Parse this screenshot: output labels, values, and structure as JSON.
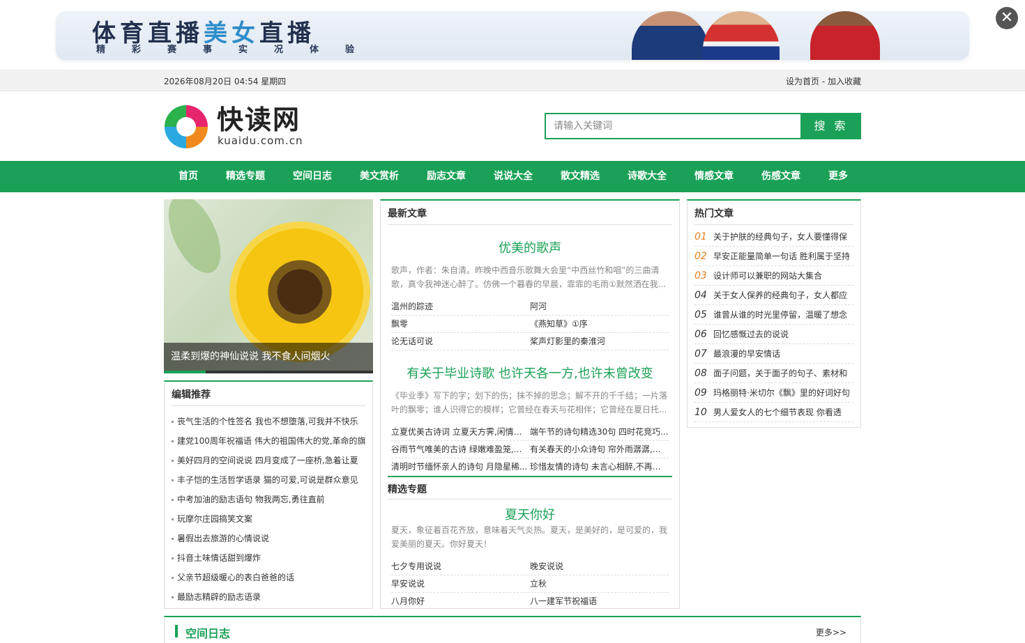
{
  "ad": {
    "title_a": "体育直播",
    "title_b": "美女",
    "title_c": "直播",
    "subtitle": "精彩赛事实况体验",
    "close_label": "✕"
  },
  "topbar": {
    "date": "2026年08月20日 04:54 星期四",
    "links": "设为首页 - 加入收藏"
  },
  "header": {
    "logo_text": "快读网",
    "logo_url": "kuaidu.com.cn",
    "search_placeholder": "请输入关键词",
    "search_button": "搜 索"
  },
  "nav": [
    "首页",
    "精选专题",
    "空间日志",
    "美文赏析",
    "励志文章",
    "说说大全",
    "散文精选",
    "诗歌大全",
    "情感文章",
    "伤感文章",
    "更多"
  ],
  "slide": {
    "caption": "温柔到爆的神仙说说 我不食人间烟火"
  },
  "editor": {
    "title": "编辑推荐",
    "items": [
      "丧气生活的个性签名 我也不想堕落,可我并不快乐",
      "建党100周年祝福语 伟大的祖国伟大的党,革命的旗",
      "美好四月的空间说说 四月变成了一座桥,急着让夏",
      "丰子恺的生活哲学语录 猫的可爱,可说是群众意见",
      "中考加油的励志语句 物我两忘,勇往直前",
      "玩摩尔庄园搞笑文案",
      "暑假出去旅游的心情说说",
      "抖音土味情话甜到爆炸",
      "父亲节超级暖心的表白爸爸的话",
      "最励志精辟的励志语录"
    ]
  },
  "latest": {
    "title": "最新文章",
    "a1": {
      "title": "优美的歌声",
      "desc": "歌声，作者：朱自清。昨晚中西音乐歌舞大会里“中西丝竹和唱”的三曲清歌，真令我神迷心醉了。仿佛一个暮春的早晨，霏霏的毛雨①默然洒在我...",
      "rows": [
        [
          "温州的踪迹",
          "阿河"
        ],
        [
          "飘零",
          "《燕知草》①序"
        ],
        [
          "论无话可说",
          "桨声灯影里的秦淮河"
        ]
      ]
    },
    "a2": {
      "title": "有关于毕业诗歌 也许天各一方,也许未曾改变",
      "desc": "《毕业季》写下的字；划下的伤；抹不掉的思念；解不开的千千结；一片落叶的飘零；谁人识得它的模样；它曾经在春天与花相伴；它曾经在夏日托...",
      "rows": [
        [
          "立夏优美古诗词 立夏天方霁,闲情喜...",
          "端午节的诗句精选30句 四时花竞巧..."
        ],
        [
          "谷雨节气唯美的古诗 绿嫩难盈笼,清...",
          "有关春天的小众诗句 帘外雨潺潺,春..."
        ],
        [
          "清明时节缅怀亲人的诗句 月隐星稀...",
          "珍惜友情的诗句 未言心相醉,不再接..."
        ]
      ]
    }
  },
  "topic": {
    "title": "精选专题",
    "headline": "夏天你好",
    "desc": "夏天，象征着百花齐放，意味着天气炎热。夏天，是美好的，是可爱的，我爱美丽的夏天。你好夏天！",
    "rows": [
      [
        "七夕专用说说",
        "晚安说说"
      ],
      [
        "早安说说",
        "立秋"
      ],
      [
        "八月你好",
        "八一建军节祝福语"
      ]
    ]
  },
  "hot": {
    "title": "热门文章",
    "items": [
      {
        "num": "01",
        "text": "关于护肤的经典句子，女人要懂得保"
      },
      {
        "num": "02",
        "text": "早安正能量简单一句话 胜利属于坚持"
      },
      {
        "num": "03",
        "text": "设计师可以兼职的网站大集合"
      },
      {
        "num": "04",
        "text": "关于女人保养的经典句子，女人都应"
      },
      {
        "num": "05",
        "text": "谁曾从谁的时光里停留，温暖了想念"
      },
      {
        "num": "06",
        "text": "回忆感慨过去的说说"
      },
      {
        "num": "07",
        "text": "最浪漫的早安情话"
      },
      {
        "num": "08",
        "text": "面子问题，关于面子的句子、素材和"
      },
      {
        "num": "09",
        "text": "玛格丽特·米切尔《飘》里的好词好句"
      },
      {
        "num": "10",
        "text": "男人爱女人的七个细节表现 你看透"
      }
    ]
  },
  "bottom": {
    "title": "空间日志",
    "more": "更多>>"
  },
  "colors": {
    "brand": "#1aa157",
    "hot_rank": "#e67e22"
  }
}
